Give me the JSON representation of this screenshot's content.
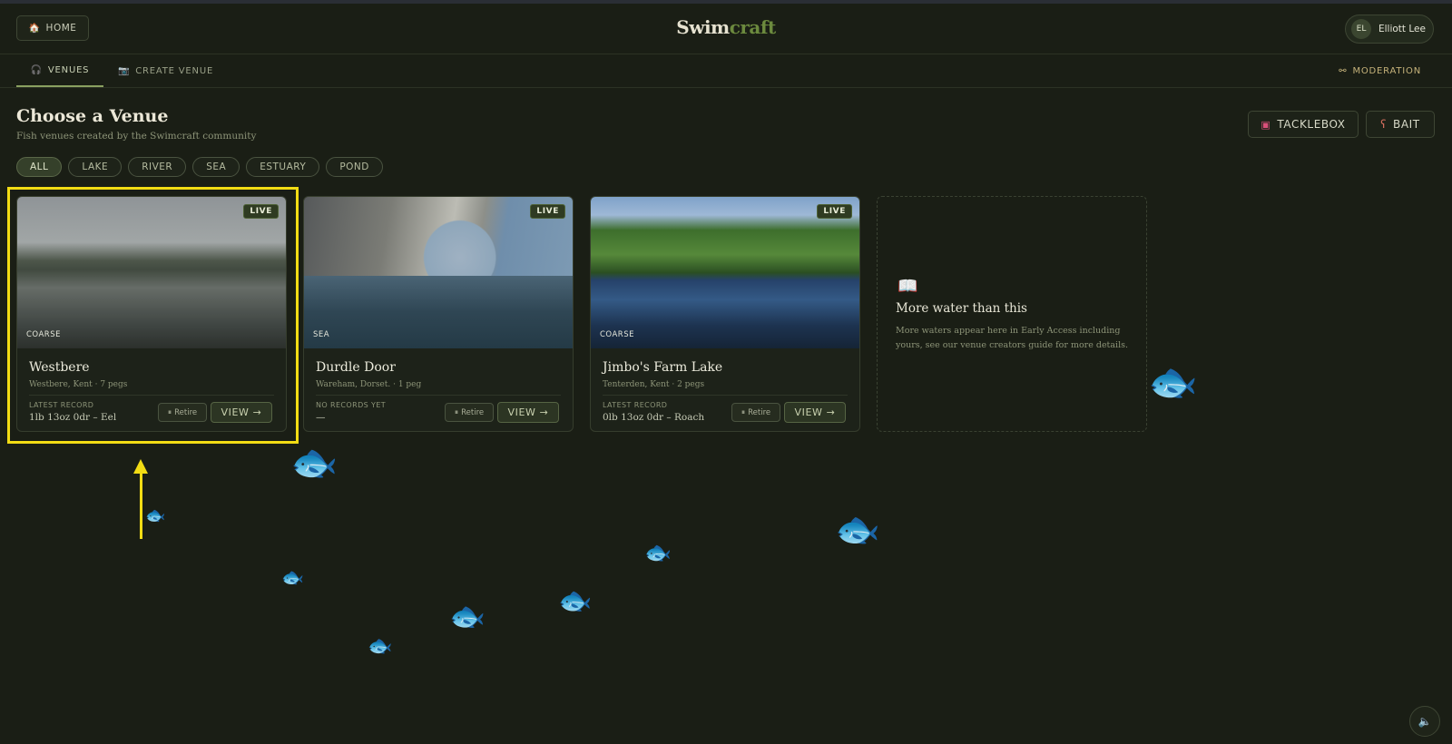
{
  "header": {
    "home_label": "HOME",
    "home_icon": "house-icon",
    "logo_part1": "Swim",
    "logo_part2": "craft",
    "user_name": "Elliott Lee",
    "user_initials": "EL"
  },
  "tabs": [
    {
      "label": "VENUES",
      "icon": "headphones-icon",
      "active": true
    },
    {
      "label": "CREATE VENUE",
      "icon": "camera-icon",
      "active": false
    },
    {
      "label": "MODERATION",
      "icon": "binoculars-icon",
      "active": false
    }
  ],
  "page": {
    "title": "Choose a Venue",
    "subtitle": "Fish venues created by the Swimcraft community"
  },
  "actions": {
    "tacklebox_label": "TACKLEBOX",
    "bait_label": "BAIT"
  },
  "filters": [
    "ALL",
    "LAKE",
    "RIVER",
    "SEA",
    "ESTUARY",
    "POND"
  ],
  "active_filter": "ALL",
  "venues": [
    {
      "name": "Westbere",
      "type": "COARSE",
      "status": "LIVE",
      "meta": "Westbere, Kent · 7 pegs",
      "record_label": "LATEST RECORD",
      "record_value": "1lb 13oz 0dr – Eel",
      "retire_label": "Retire",
      "view_label": "VIEW →"
    },
    {
      "name": "Durdle Door",
      "type": "SEA",
      "status": "LIVE",
      "meta": "Wareham, Dorset. · 1 peg",
      "record_label": "NO RECORDS YET",
      "record_value": "—",
      "retire_label": "Retire",
      "view_label": "VIEW →"
    },
    {
      "name": "Jimbo's Farm Lake",
      "type": "COARSE",
      "status": "LIVE",
      "meta": "Tenterden, Kent · 2 pegs",
      "record_label": "LATEST RECORD",
      "record_value": "0lb 13oz 0dr – Roach",
      "retire_label": "Retire",
      "view_label": "VIEW →"
    }
  ],
  "more_card": {
    "icon": "book-icon",
    "title": "More water than this",
    "text": "More waters appear here in Early Access including yours, see our venue creators guide for more details."
  },
  "annotation": {
    "color": "#f2dc14"
  }
}
